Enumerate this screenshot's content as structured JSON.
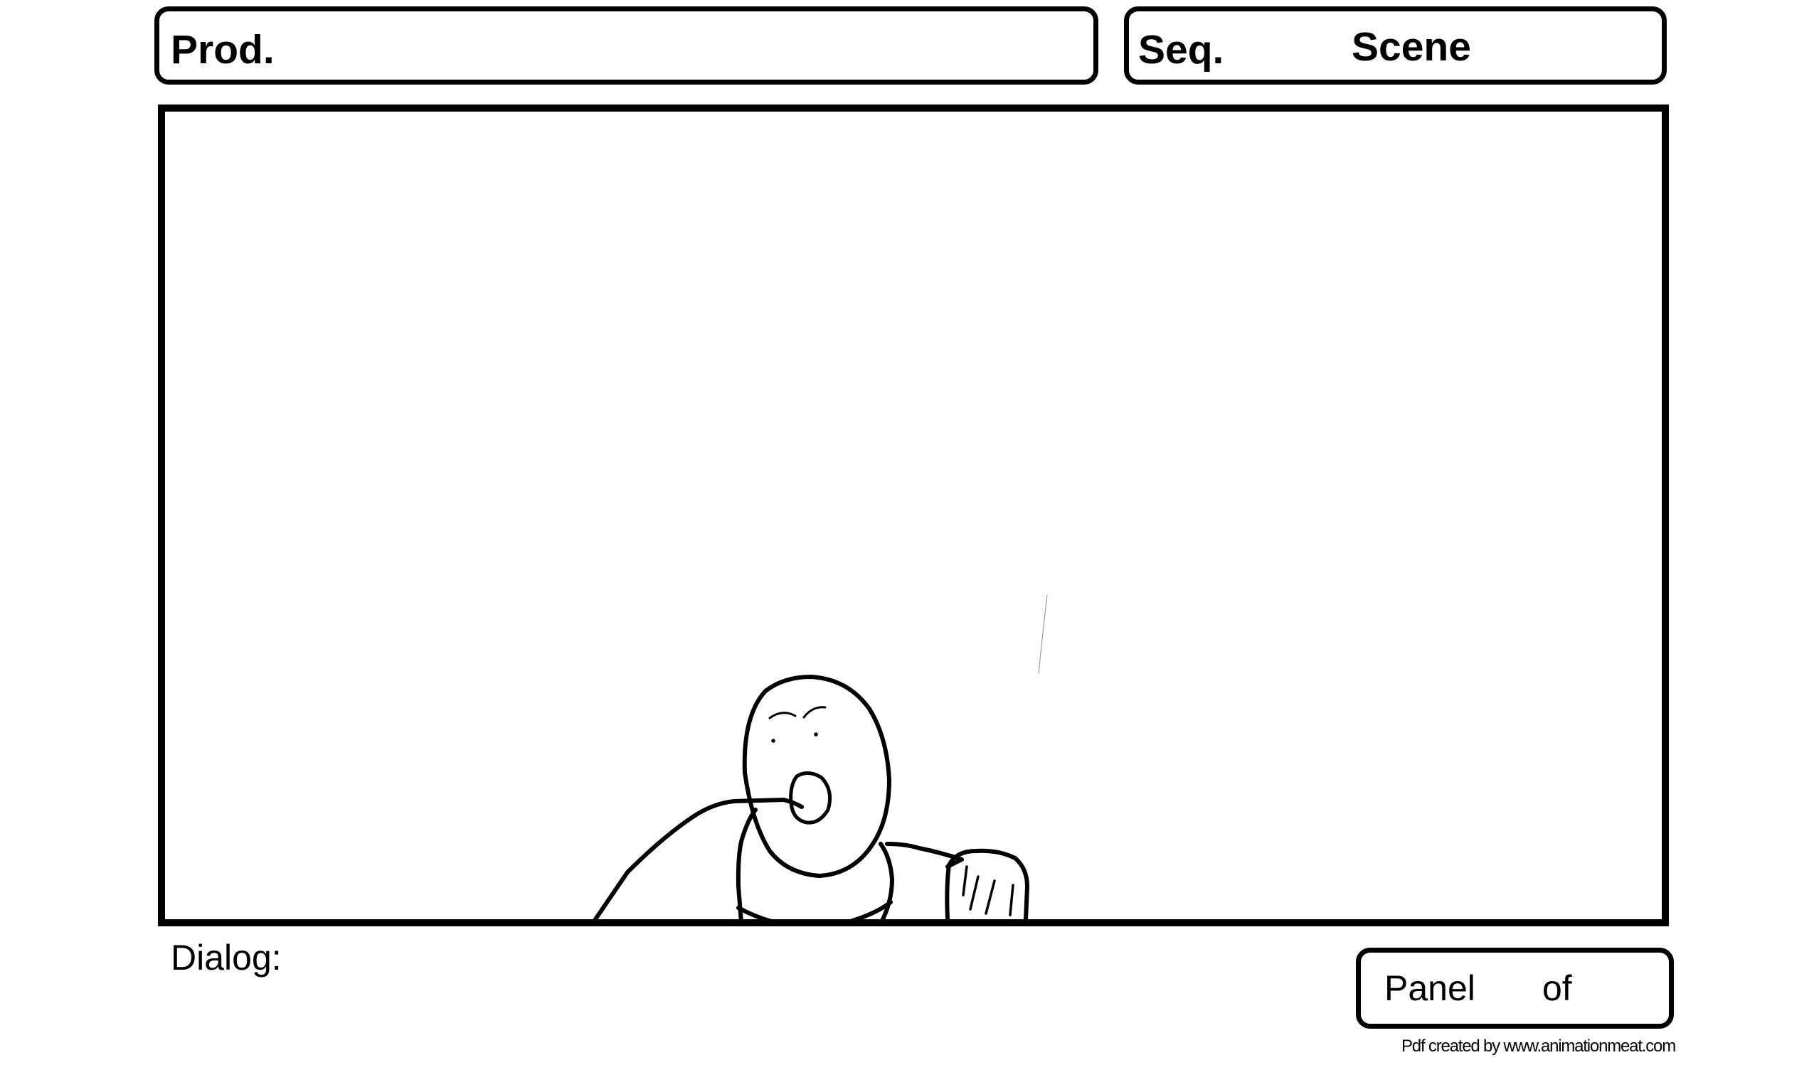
{
  "header": {
    "production_label": "Prod.",
    "sequence_label": "Seq.",
    "scene_label": "Scene"
  },
  "footer": {
    "dialog_label": "Dialog:",
    "panel_label": "Panel",
    "of_label": "of",
    "credit": "Pdf created by www.animationmeat.com"
  },
  "panel_drawing": {
    "subject": "character-sketch",
    "stroke_color": "#000000",
    "background_color": "#ffffff"
  }
}
